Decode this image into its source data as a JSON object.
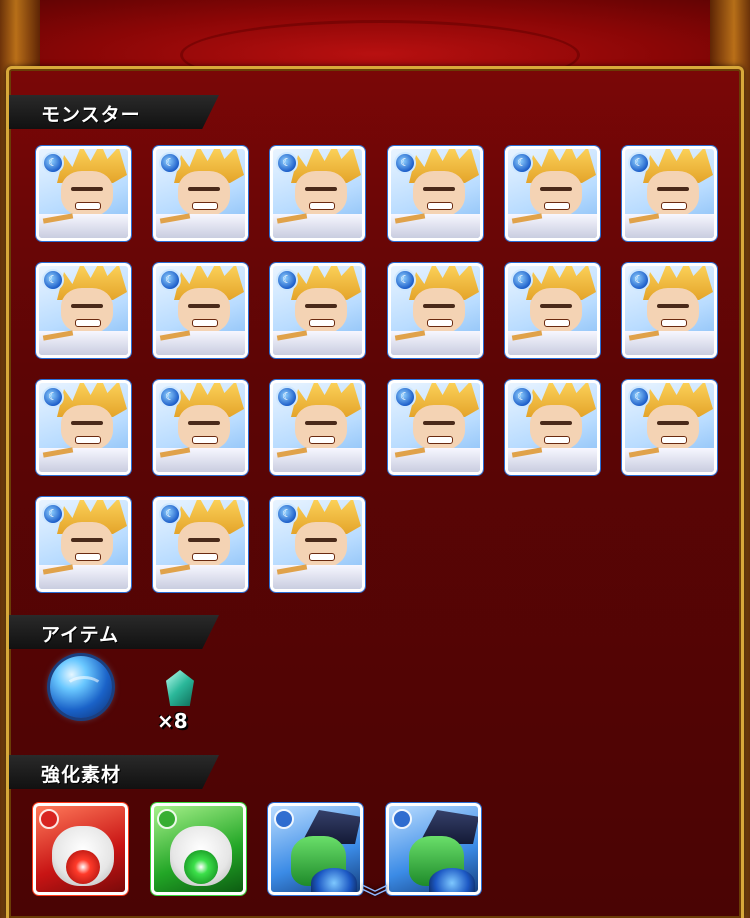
{
  "sections": {
    "monsters": {
      "label": "モンスター",
      "count": 21
    },
    "items": {
      "label": "アイテム",
      "gem_count": "×8"
    },
    "materials": {
      "label": "強化素材"
    }
  },
  "monster_cards": [
    {
      "row": 0,
      "col": 0
    },
    {
      "row": 0,
      "col": 1
    },
    {
      "row": 0,
      "col": 2
    },
    {
      "row": 0,
      "col": 3
    },
    {
      "row": 0,
      "col": 4
    },
    {
      "row": 0,
      "col": 5
    },
    {
      "row": 1,
      "col": 0
    },
    {
      "row": 1,
      "col": 1
    },
    {
      "row": 1,
      "col": 2
    },
    {
      "row": 1,
      "col": 3
    },
    {
      "row": 1,
      "col": 4
    },
    {
      "row": 1,
      "col": 5
    },
    {
      "row": 2,
      "col": 0
    },
    {
      "row": 2,
      "col": 1
    },
    {
      "row": 2,
      "col": 2
    },
    {
      "row": 2,
      "col": 3
    },
    {
      "row": 2,
      "col": 4
    },
    {
      "row": 2,
      "col": 5
    },
    {
      "row": 3,
      "col": 0
    },
    {
      "row": 3,
      "col": 1
    },
    {
      "row": 3,
      "col": 2
    }
  ],
  "materials": [
    {
      "type": "red",
      "icon": "red-egg-material-icon"
    },
    {
      "type": "green",
      "icon": "green-egg-material-icon"
    },
    {
      "type": "blue1",
      "icon": "blue-dragon-material-icon"
    },
    {
      "type": "blue2",
      "icon": "blue-dragon-material-icon"
    }
  ],
  "colors": {
    "panel_border": "#d8a93a",
    "panel_bg": "#5d0505",
    "water_attr": "#1d5ec9"
  },
  "icons": {
    "water_badge": "water-element-icon",
    "orb": "orb-icon",
    "gem": "gem-icon",
    "scroll": "chevron-down-icon"
  }
}
